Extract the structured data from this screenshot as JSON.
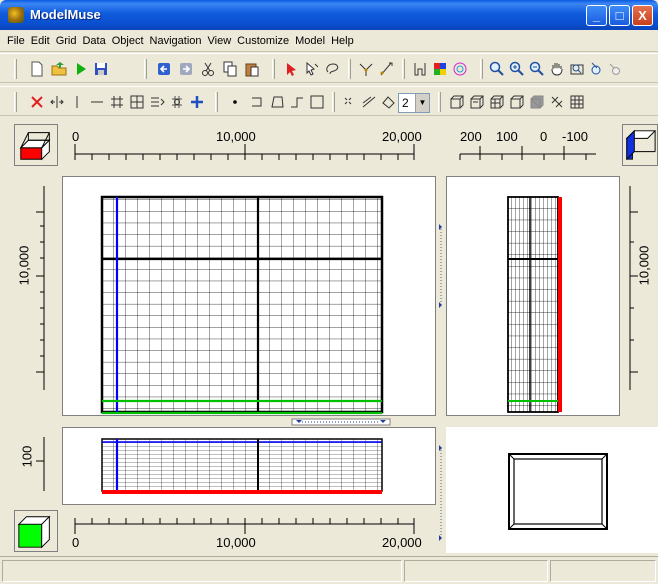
{
  "window": {
    "title": "ModelMuse"
  },
  "window_controls": {
    "minimize": "_",
    "maximize": "□",
    "close": "X"
  },
  "menu": [
    "File",
    "Edit",
    "Grid",
    "Data",
    "Object",
    "Navigation",
    "View",
    "Customize",
    "Model",
    "Help"
  ],
  "toolbar": {
    "layer_value": "2"
  },
  "top_view": {
    "h_ruler_labels": [
      "0",
      "10,000",
      "20,000"
    ],
    "v_ruler_labels": [
      "10,000"
    ]
  },
  "side_view": {
    "h_ruler_labels": [
      "200",
      "100",
      "0",
      "-100"
    ],
    "v_ruler_labels": [
      "10,000"
    ]
  },
  "front_view": {
    "v_ruler_labels": [
      "100"
    ],
    "h_ruler_labels": [
      "0",
      "10,000",
      "20,000"
    ]
  },
  "colors": {
    "row_highlight": "#00c000",
    "column_highlight": "#0000ff",
    "layer_highlight": "#ff0000"
  }
}
